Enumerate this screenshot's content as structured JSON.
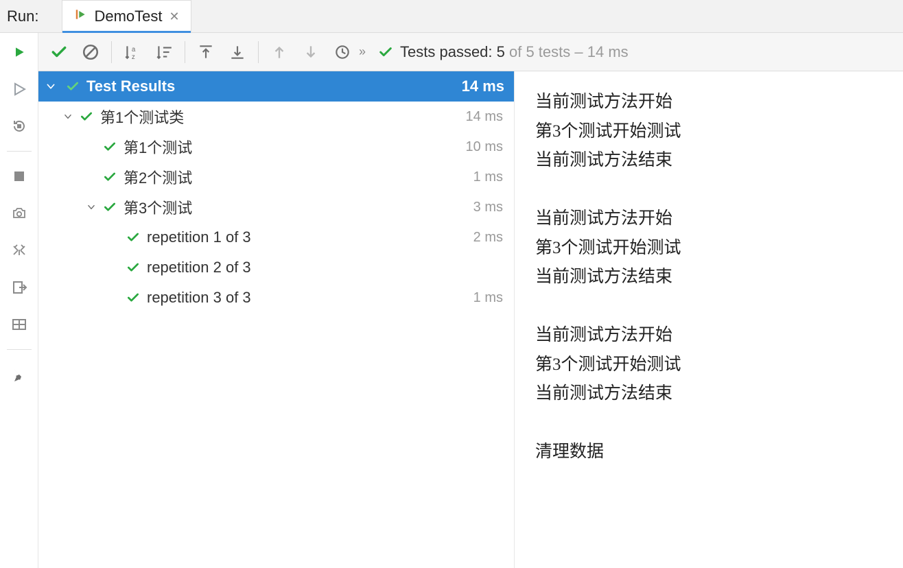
{
  "header": {
    "run_label": "Run:",
    "tab_title": "DemoTest"
  },
  "status": {
    "prefix": "Tests passed: 5",
    "suffix": " of 5 tests – 14 ms"
  },
  "tree": {
    "root": {
      "label": "Test Results",
      "time": "14 ms"
    },
    "nodes": [
      {
        "indent": 1,
        "expand": true,
        "label": "第1个测试类",
        "time": "14 ms"
      },
      {
        "indent": 2,
        "expand": null,
        "label": "第1个测试",
        "time": "10 ms"
      },
      {
        "indent": 2,
        "expand": null,
        "label": "第2个测试",
        "time": "1 ms"
      },
      {
        "indent": 2,
        "expand": true,
        "label": "第3个测试",
        "time": "3 ms"
      },
      {
        "indent": 3,
        "expand": null,
        "label": "repetition 1 of 3",
        "time": "2 ms"
      },
      {
        "indent": 3,
        "expand": null,
        "label": "repetition 2 of 3",
        "time": ""
      },
      {
        "indent": 3,
        "expand": null,
        "label": "repetition 3 of 3",
        "time": "1 ms"
      }
    ]
  },
  "console_lines": [
    "当前测试方法开始",
    "第3个测试开始测试",
    "当前测试方法结束",
    "",
    "当前测试方法开始",
    "第3个测试开始测试",
    "当前测试方法结束",
    "",
    "当前测试方法开始",
    "第3个测试开始测试",
    "当前测试方法结束",
    "",
    "清理数据"
  ],
  "colors": {
    "green": "#2aa83f",
    "selection": "#2f86d4"
  }
}
